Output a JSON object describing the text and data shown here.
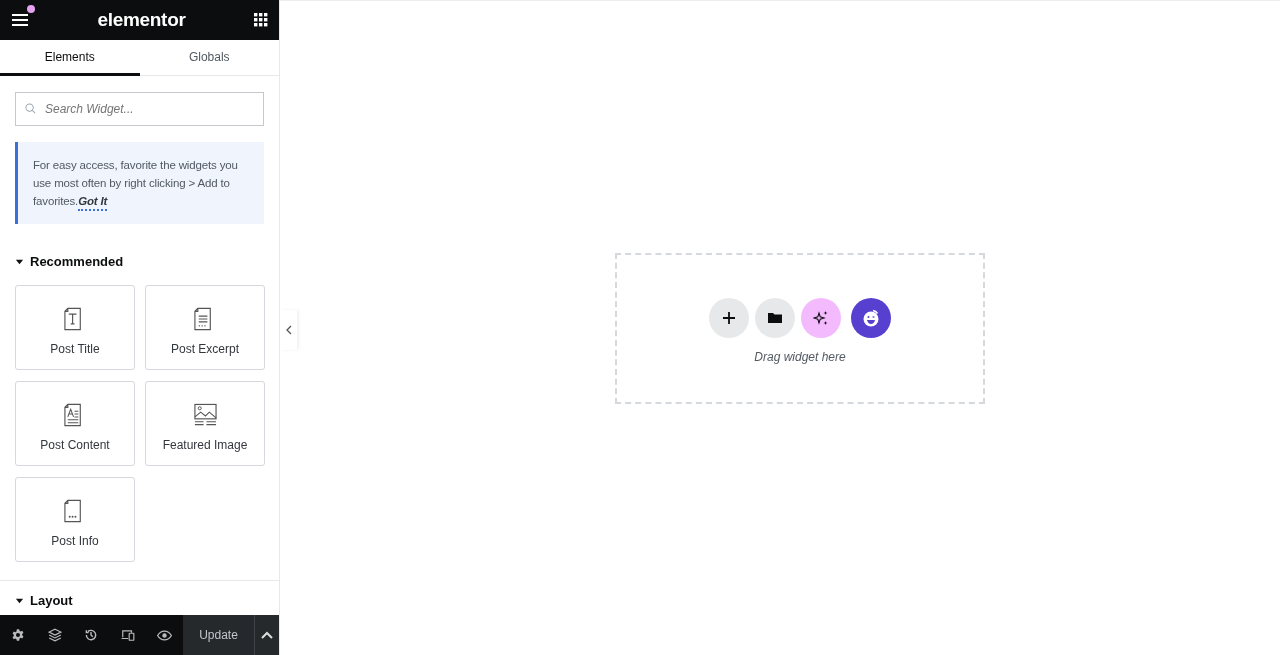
{
  "header": {
    "logo": "elementor",
    "notification": true
  },
  "tabs": [
    {
      "label": "Elements",
      "selected": true
    },
    {
      "label": "Globals",
      "selected": false
    }
  ],
  "search": {
    "placeholder": "Search Widget..."
  },
  "notice": {
    "text": "For easy access, favorite the widgets you use most often by right clicking > Add to favorites.",
    "link": "Got It"
  },
  "sections": [
    {
      "title": "Recommended",
      "expanded": true,
      "widgets": [
        {
          "label": "Post Title",
          "kind": "title"
        },
        {
          "label": "Post Excerpt",
          "kind": "excerpt"
        },
        {
          "label": "Post Content",
          "kind": "content"
        },
        {
          "label": "Featured Image",
          "kind": "image"
        },
        {
          "label": "Post Info",
          "kind": "info"
        }
      ]
    },
    {
      "title": "Layout",
      "expanded": true
    }
  ],
  "footer": {
    "update": "Update"
  },
  "canvas": {
    "hint": "Drag widget here"
  }
}
